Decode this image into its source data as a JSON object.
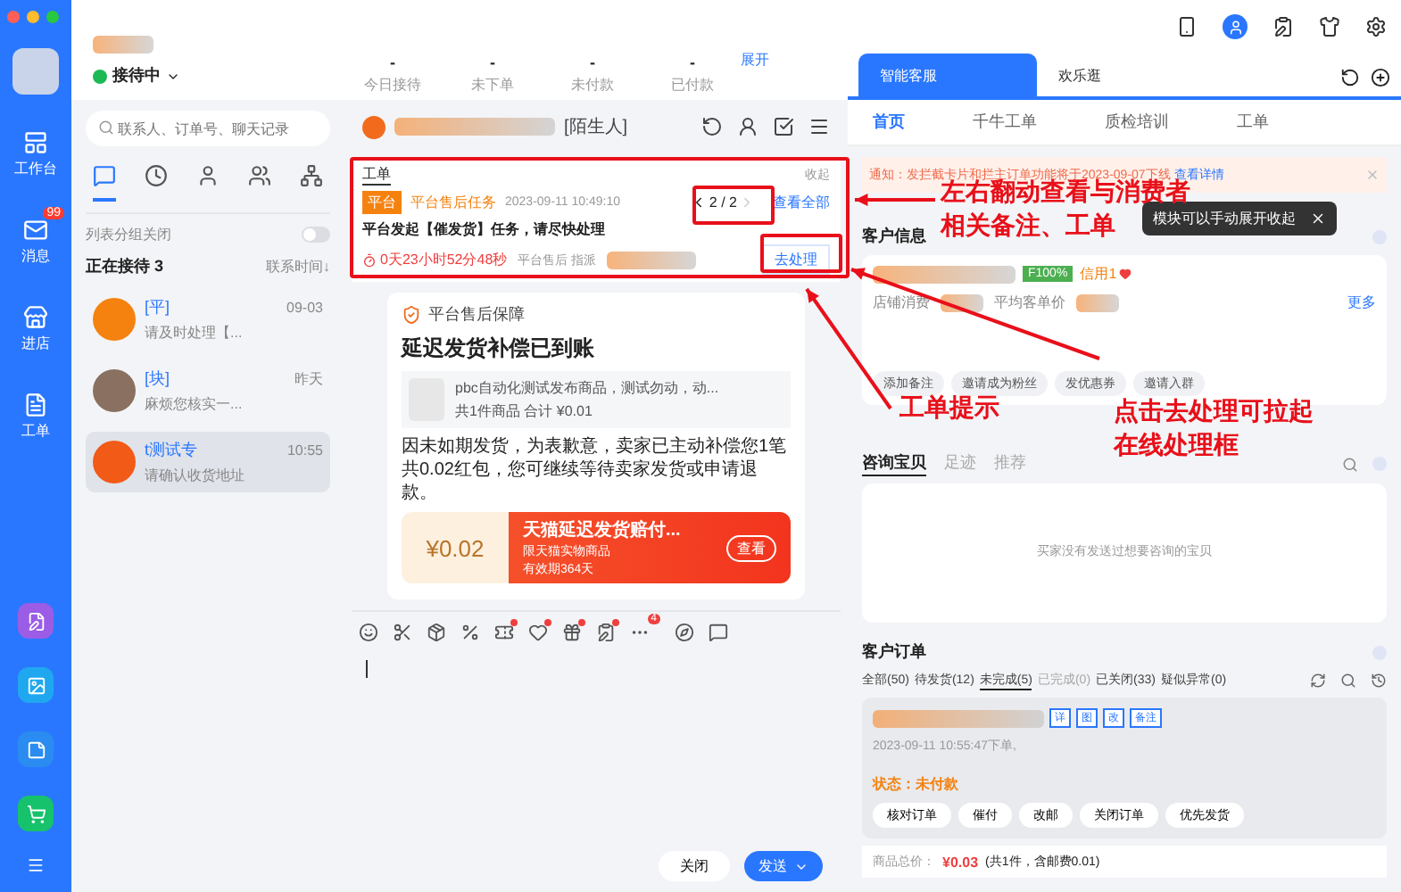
{
  "sidebar": {
    "items": [
      {
        "label": "工作台",
        "kind": "desk"
      },
      {
        "label": "消息",
        "kind": "mail",
        "badge": "99"
      },
      {
        "label": "进店",
        "kind": "store"
      },
      {
        "label": "工单",
        "kind": "order"
      }
    ]
  },
  "status": "接待中",
  "stats": [
    {
      "label": "今日接待",
      "value": "-"
    },
    {
      "label": "未下单",
      "value": "-"
    },
    {
      "label": "未付款",
      "value": "-"
    },
    {
      "label": "已付款",
      "value": "-"
    }
  ],
  "expand": "展开",
  "search": {
    "placeholder": "联系人、订单号、聊天记录"
  },
  "contact_tabs": [
    {
      "kind": "chat",
      "selected": true
    },
    {
      "kind": "clock",
      "selected": false
    },
    {
      "kind": "user",
      "selected": false
    },
    {
      "kind": "users",
      "selected": false
    },
    {
      "kind": "tree",
      "selected": false
    }
  ],
  "group_toggle": {
    "label": "列表分组关闭",
    "on": false
  },
  "section": {
    "title": "正在接待",
    "count": "3",
    "sort": "联系时间↓"
  },
  "contacts": [
    {
      "name": "[平]",
      "preview": "请及时处理【...",
      "time": "09-03",
      "selected": false,
      "color": "#f5820f"
    },
    {
      "name": "[块]",
      "preview": "麻烦您核实一...",
      "time": "昨天",
      "selected": false,
      "color": "#8a7060"
    },
    {
      "name": "t测试专",
      "preview": "请确认收货地址",
      "time": "10:55",
      "selected": true,
      "color": "#f25a18"
    }
  ],
  "chat": {
    "name": "[陌生人]",
    "work_order": {
      "tab": "工单",
      "collapse": "收起",
      "tag": "平台",
      "type": "平台售后任务",
      "time": "2023-09-11 10:49:10",
      "pager": "2 / 2",
      "view_all": "查看全部",
      "message": "平台发起【催发货】任务，请尽快处理",
      "countdown": "0天23小时52分48秒",
      "assign": "平台售后 指派",
      "action": "去处理"
    },
    "card": {
      "source": "平台售后保障",
      "title": "延迟发货补偿已到账",
      "product": "pbc自动化测试发布商品，测试勿动，动...",
      "summary": "共1件商品  合计 ¥0.01",
      "body": "因未如期发货，为表歉意，卖家已主动补偿您1笔共0.02红包，您可继续等待卖家发货或申请退款。",
      "coupon": {
        "amount": "¥0.02",
        "title": "天猫延迟发货赔付...",
        "scope": "限天猫实物商品",
        "validity": "有效期364天",
        "action": "查看"
      }
    },
    "more_badge": "4",
    "close": "关闭",
    "send": "发送"
  },
  "right": {
    "tabs": [
      {
        "label": "智能客服",
        "selected": true
      },
      {
        "label": "欢乐逛",
        "selected": false
      }
    ],
    "subtabs": [
      {
        "label": "首页",
        "selected": true
      },
      {
        "label": "千牛工单",
        "selected": false
      },
      {
        "label": "质检培训",
        "selected": false
      },
      {
        "label": "工单",
        "selected": false
      }
    ],
    "notice": {
      "text": "通知：发拦截卡片和拦主订单功能将于2023-09-07下线",
      "link": "查看详情"
    },
    "customer": {
      "title": "客户信息",
      "tooltip": "模块可以手动展开收起",
      "rate": "F100%",
      "credit": "信用1",
      "fields": [
        "店铺消费",
        "平均客单价"
      ],
      "more": "更多",
      "actions": [
        "添加备注",
        "邀请成为粉丝",
        "发优惠券",
        "邀请入群"
      ]
    },
    "consult": {
      "tabs": [
        {
          "label": "咨询宝贝",
          "selected": true
        },
        {
          "label": "足迹",
          "selected": false
        },
        {
          "label": "推荐",
          "selected": false
        }
      ],
      "empty": "买家没有发送过想要咨询的宝贝"
    },
    "orders": {
      "title": "客户订单",
      "tabs": [
        {
          "label": "全部(50)",
          "selected": false,
          "disabled": false
        },
        {
          "label": "待发货(12)",
          "selected": false,
          "disabled": false
        },
        {
          "label": "未完成(5)",
          "selected": true,
          "disabled": false
        },
        {
          "label": "已完成(0)",
          "selected": false,
          "disabled": true
        },
        {
          "label": "已关闭(33)",
          "selected": false,
          "disabled": false
        },
        {
          "label": "疑似异常(0)",
          "selected": false,
          "disabled": false
        }
      ],
      "tags": [
        "详",
        "图",
        "改",
        "备注"
      ],
      "time": "2023-09-11 10:55:47下单,",
      "status": "状态：未付款",
      "buttons": [
        "核对订单",
        "催付",
        "改邮",
        "关闭订单",
        "优先发货"
      ],
      "total_label": "商品总价：",
      "total": "¥0.03",
      "total_note": "(共1件，含邮费0.01)"
    }
  },
  "annotations": [
    {
      "lines": [
        "左右翻动查看与消费者",
        "相关备注、工单"
      ]
    },
    {
      "lines": [
        "工单提示"
      ]
    },
    {
      "lines": [
        "点击去处理可拉起",
        "在线处理框"
      ]
    }
  ]
}
